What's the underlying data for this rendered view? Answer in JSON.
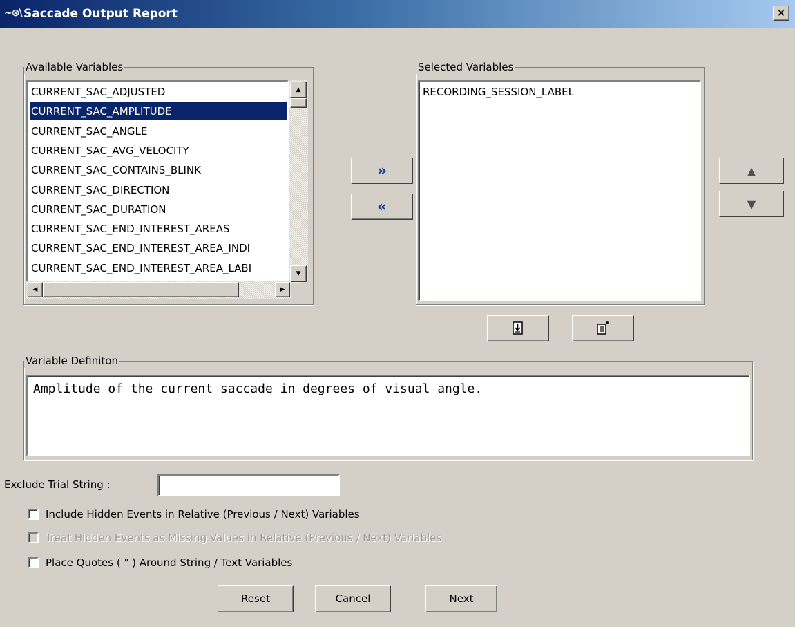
{
  "window": {
    "icon": "eye-wave-icon",
    "title": "Saccade Output Report",
    "close_glyph": "×"
  },
  "available": {
    "legend": "Available Variables",
    "items": [
      "CURRENT_SAC_ADJUSTED",
      "CURRENT_SAC_AMPLITUDE",
      "CURRENT_SAC_ANGLE",
      "CURRENT_SAC_AVG_VELOCITY",
      "CURRENT_SAC_CONTAINS_BLINK",
      "CURRENT_SAC_DIRECTION",
      "CURRENT_SAC_DURATION",
      "CURRENT_SAC_END_INTEREST_AREAS",
      "CURRENT_SAC_END_INTEREST_AREA_INDI",
      "CURRENT_SAC_END_INTEREST_AREA_LABI"
    ],
    "selected_index": 1
  },
  "selected": {
    "legend": "Selected Variables",
    "items": [
      "RECORDING_SESSION_LABEL"
    ]
  },
  "transfer": {
    "add_glyph": "»",
    "remove_glyph": "«"
  },
  "order": {
    "up_glyph": "▲",
    "down_glyph": "▼"
  },
  "file_buttons": {
    "load_icon": "load-list-icon",
    "save_icon": "save-list-icon"
  },
  "definition": {
    "legend": "Variable Definiton",
    "text": "Amplitude of the current saccade in degrees of visual angle."
  },
  "exclude": {
    "label": "Exclude Trial String :",
    "value": ""
  },
  "options": [
    {
      "label": "Include Hidden Events in Relative (Previous / Next) Variables",
      "checked": false,
      "enabled": true
    },
    {
      "label": "Treat Hidden Events as Missing Values in Relative (Previous / Next) Variables",
      "checked": false,
      "enabled": false
    },
    {
      "label": "Place Quotes ( \" ) Around String /  Text Variables",
      "checked": false,
      "enabled": true
    }
  ],
  "footer": {
    "reset": "Reset",
    "cancel": "Cancel",
    "next": "Next"
  },
  "colors": {
    "selection": "#0a246a",
    "dialog_bg": "#d4d0c8",
    "title_start": "#0a246a",
    "title_end": "#a6caf0"
  }
}
